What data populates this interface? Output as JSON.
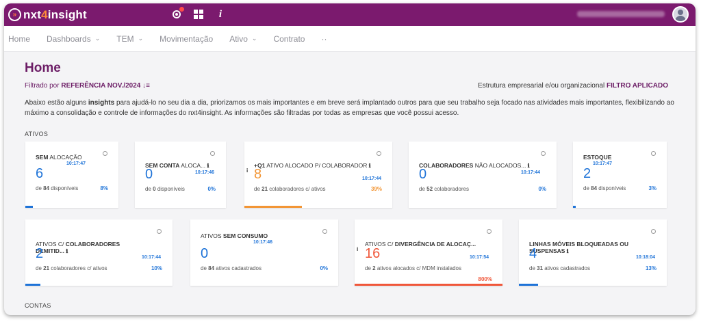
{
  "app": {
    "logo_mark": "»",
    "logo_pre": "nxt",
    "logo_four": "4",
    "logo_post": "insight",
    "info_glyph": "i"
  },
  "nav": [
    {
      "label": "Home",
      "chevron": false
    },
    {
      "label": "Dashboards",
      "chevron": true
    },
    {
      "label": "TEM",
      "chevron": true
    },
    {
      "label": "Movimentação",
      "chevron": false
    },
    {
      "label": "Ativo",
      "chevron": true
    },
    {
      "label": "Contrato",
      "chevron": false
    },
    {
      "label": "··",
      "chevron": false
    }
  ],
  "page": {
    "title": "Home",
    "filter_prefix": "Filtrado por",
    "filter_value": "REFERÊNCIA NOV./2024",
    "filter_icon": "↓≡",
    "org_text": "Estrutura empresarial e/ou organizacional",
    "org_status": "FILTRO APLICADO",
    "desc_1": "Abaixo estão alguns",
    "desc_bold": "insights",
    "desc_2": "para ajudá-lo no seu dia a dia, priorizamos os mais importantes e em breve será implantado outros para que seu trabalho seja focado nas atividades mais importantes, flexibilizando ao máximo a consolidação e controle de informações do nxt4insight. As informações são filtradas por todas as empresas que você possui acesso.",
    "section_ativos": "ATIVOS",
    "section_contas": "CONTAS"
  },
  "cards_row1": [
    {
      "title_bold": "SEM",
      "title_rest": " ALOCAÇÃO",
      "time": "10:17:47",
      "value": "6",
      "sub_pre": "de",
      "sub_num": "84",
      "sub_post": "disponíveis",
      "pct": "8%",
      "progress": 0.08,
      "color": "blue"
    },
    {
      "title_bold": "SEM CONTA",
      "title_rest": " ALOCA...",
      "time": "10:17:46",
      "value": "0",
      "sub_pre": "de",
      "sub_num": "0",
      "sub_post": "disponíveis",
      "pct": "0%",
      "progress": 0,
      "color": "blue"
    },
    {
      "title_bold": "+Q1",
      "title_rest": " ATIVO ALOCADO P/ COLABORADOR",
      "time": "10:17:44",
      "value": "8",
      "sub_pre": "de",
      "sub_num": "21",
      "sub_post": "colaboradores c/ ativos",
      "pct": "39%",
      "progress": 0.39,
      "color": "orange"
    },
    {
      "title_bold": "COLABORADORES",
      "title_rest": " NÃO ALOCADOS...",
      "time": "10:17:44",
      "value": "0",
      "sub_pre": "de",
      "sub_num": "52",
      "sub_post": "colaboradores",
      "pct": "0%",
      "progress": 0,
      "color": "blue"
    },
    {
      "title_bold": "ESTOQUE",
      "title_rest": "",
      "time": "10:17:47",
      "value": "2",
      "sub_pre": "de",
      "sub_num": "84",
      "sub_post": "disponíveis",
      "pct": "3%",
      "progress": 0.03,
      "color": "blue"
    }
  ],
  "cards_row2": [
    {
      "title_bold": "",
      "title_rest": "ATIVOS C/ ",
      "title_bold2": "COLABORADORES",
      "title_line2": "DEMITID...",
      "time": "10:17:44",
      "value": "2",
      "sub_pre": "de",
      "sub_num": "21",
      "sub_post": "colaboradores c/ ativos",
      "pct": "10%",
      "progress": 0.1,
      "color": "blue"
    },
    {
      "title_bold": "",
      "title_rest": "ATIVOS ",
      "title_bold2": "SEM CONSUMO",
      "title_line2": "",
      "time": "10:17:46",
      "value": "0",
      "sub_pre": "de",
      "sub_num": "84",
      "sub_post": "ativos cadastrados",
      "pct": "0%",
      "progress": 0,
      "color": "blue"
    },
    {
      "title_bold": "",
      "title_rest": "ATIVOS C/ ",
      "title_bold2": "DIVERGÊNCIA DE ALOCAÇ...",
      "title_line2": "",
      "time": "10:17:54",
      "value": "16",
      "sub_pre": "de",
      "sub_num": "2",
      "sub_post": "ativos alocados c/ MDM instalados",
      "pct": "800%",
      "progress": 1.0,
      "color": "red"
    },
    {
      "title_bold": "LINHAS MÓVEIS BLOQUEADAS OU",
      "title_rest": "",
      "title_bold2": "",
      "title_line2": "SUSPENSAS",
      "time": "10:18:04",
      "value": "4",
      "sub_pre": "de",
      "sub_num": "31",
      "sub_post": "ativos cadastrados",
      "pct": "13%",
      "progress": 0.13,
      "color": "blue"
    }
  ],
  "colors": {
    "brand": "#7b1a6e",
    "blue": "#1e73d8",
    "orange": "#f29534",
    "red": "#f0573a"
  }
}
